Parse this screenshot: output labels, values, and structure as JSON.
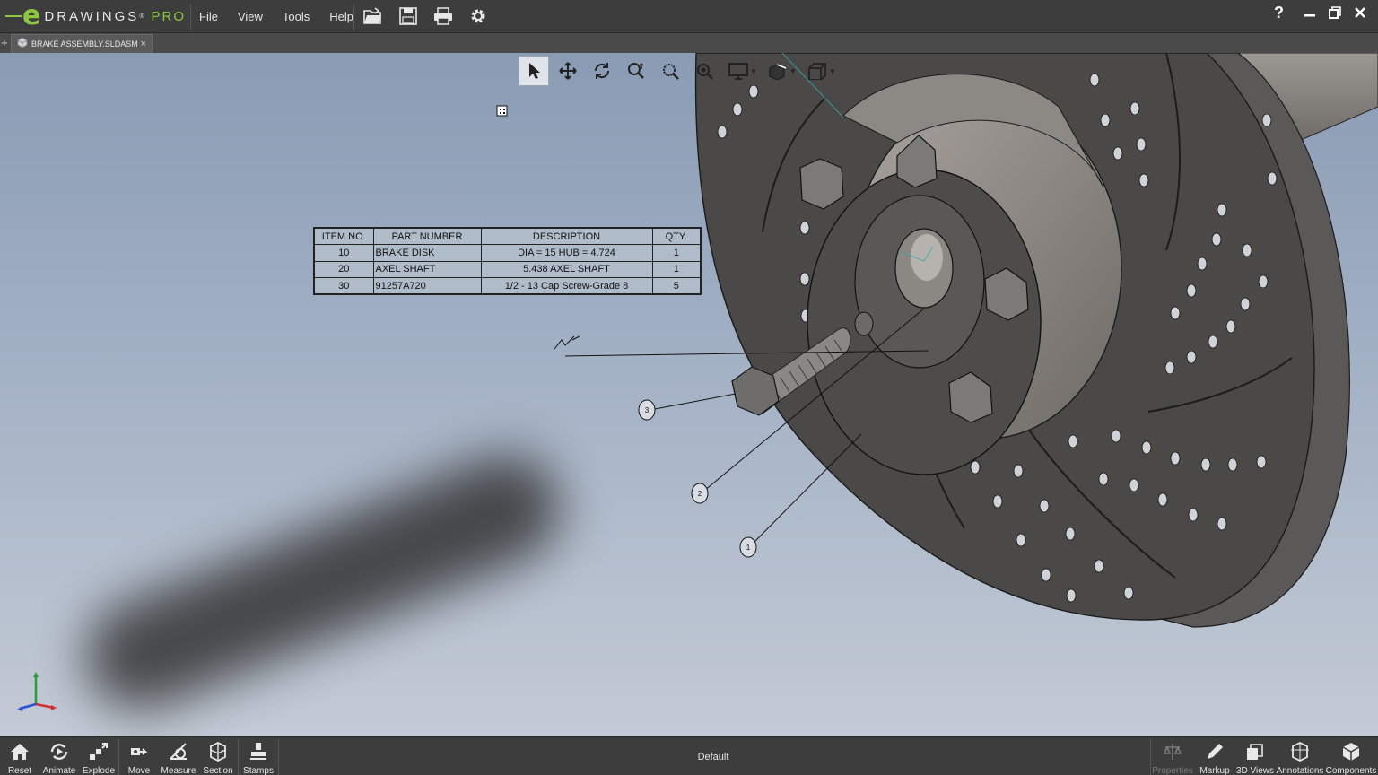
{
  "app": {
    "logo_letter": "e",
    "name": "DRAWINGS",
    "edition": "PRO",
    "help_label": "?",
    "window_controls": [
      "minimize-icon",
      "restore-icon",
      "close-icon"
    ]
  },
  "menu": [
    "File",
    "View",
    "Tools",
    "Help"
  ],
  "toolbar_icons": [
    "open-icon",
    "save-icon",
    "print-icon",
    "settings-icon"
  ],
  "tab": {
    "label": "BRAKE ASSEMBLY.SLDASM",
    "close": "×",
    "add": "+"
  },
  "view_toolbar": [
    "select-icon",
    "pan-icon",
    "rotate-icon",
    "zoom-icon",
    "zoom-to-area-icon",
    "zoom-to-fit-icon",
    "display-style-icon",
    "shadows-icon",
    "view-orientation-icon"
  ],
  "bom": {
    "headers": [
      "ITEM NO.",
      "PART NUMBER",
      "DESCRIPTION",
      "QTY."
    ],
    "rows": [
      [
        "10",
        "BRAKE DISK",
        "DIA = 15 HUB = 4.724",
        "1"
      ],
      [
        "20",
        "AXEL SHAFT",
        "5.438 AXEL SHAFT",
        "1"
      ],
      [
        "30",
        "91257A720",
        "1/2 - 13 Cap Screw-Grade 8",
        "5"
      ]
    ]
  },
  "balloons": [
    "3",
    "2",
    "1"
  ],
  "bottom_tools_left": [
    {
      "label": "Reset",
      "icon": "home-icon"
    },
    {
      "label": "Animate",
      "icon": "animate-icon"
    },
    {
      "label": "Explode",
      "icon": "explode-icon"
    },
    {
      "label": "Move",
      "icon": "move-icon"
    },
    {
      "label": "Measure",
      "icon": "measure-icon"
    },
    {
      "label": "Section",
      "icon": "section-icon"
    },
    {
      "label": "Stamps",
      "icon": "stamps-icon"
    }
  ],
  "configuration": "Default",
  "bottom_tools_right": [
    {
      "label": "Properties",
      "icon": "properties-icon",
      "enabled": false
    },
    {
      "label": "Markup",
      "icon": "markup-icon",
      "enabled": true
    },
    {
      "label": "3D Views",
      "icon": "3d-views-icon",
      "enabled": true
    },
    {
      "label": "Annotations",
      "icon": "annotations-icon",
      "enabled": true
    },
    {
      "label": "Components",
      "icon": "components-icon",
      "enabled": true
    }
  ]
}
